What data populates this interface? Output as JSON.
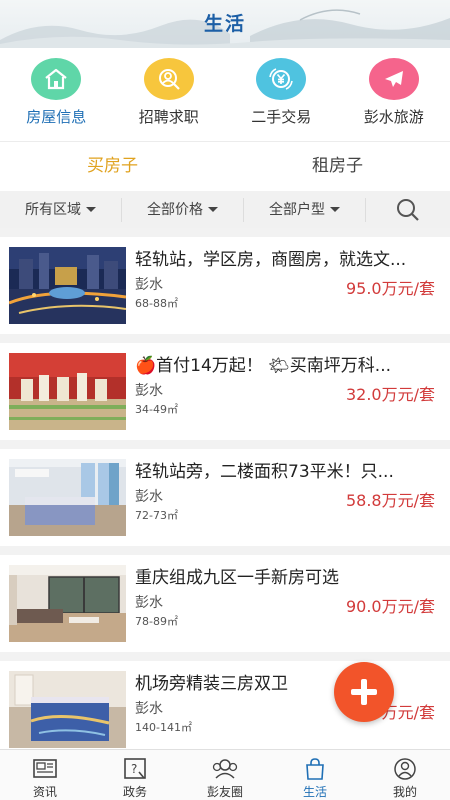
{
  "header": {
    "title": "生活"
  },
  "quick_links": [
    {
      "label": "房屋信息",
      "icon": "house-icon",
      "color": "#5fd6a8",
      "active": true
    },
    {
      "label": "招聘求职",
      "icon": "person-search-icon",
      "color": "#f7c63d",
      "active": false
    },
    {
      "label": "二手交易",
      "icon": "yen-exchange-icon",
      "color": "#4fc3e0",
      "active": false
    },
    {
      "label": "彭水旅游",
      "icon": "airplane-icon",
      "color": "#f5648c",
      "active": false
    }
  ],
  "buy_tabs": [
    {
      "label": "买房子",
      "active": true
    },
    {
      "label": "租房子",
      "active": false
    }
  ],
  "filters": [
    {
      "label": "所有区域"
    },
    {
      "label": "全部价格"
    },
    {
      "label": "全部户型"
    }
  ],
  "listings": [
    {
      "title": "轻轨站，学区房，商圈房，就选文...",
      "area": "彭水",
      "size": "68-88㎡",
      "price": "95.0万元/套"
    },
    {
      "title": "🍎首付14万起！ 🌤买南坪万科...",
      "area": "彭水",
      "size": "34-49㎡",
      "price": "32.0万元/套"
    },
    {
      "title": "轻轨站旁，二楼面积73平米！只...",
      "area": "彭水",
      "size": "72-73㎡",
      "price": "58.8万元/套"
    },
    {
      "title": "重庆组成九区一手新房可选",
      "area": "彭水",
      "size": "78-89㎡",
      "price": "90.0万元/套"
    },
    {
      "title": "机场旁精装三房双卫",
      "area": "彭水",
      "size": "140-141㎡",
      "price": "82.0万元/套"
    }
  ],
  "tabbar": [
    {
      "label": "资讯",
      "icon": "news-icon",
      "active": false
    },
    {
      "label": "政务",
      "icon": "government-icon",
      "active": false
    },
    {
      "label": "彭友圈",
      "icon": "friends-icon",
      "active": false
    },
    {
      "label": "生活",
      "icon": "shopping-bag-icon",
      "active": true
    },
    {
      "label": "我的",
      "icon": "profile-icon",
      "active": false
    }
  ],
  "colors": {
    "accent_blue": "#1f6fb5",
    "active_tab_gold": "#e0a21f",
    "price_red": "#d23b3b",
    "fab_orange": "#f2542a"
  }
}
